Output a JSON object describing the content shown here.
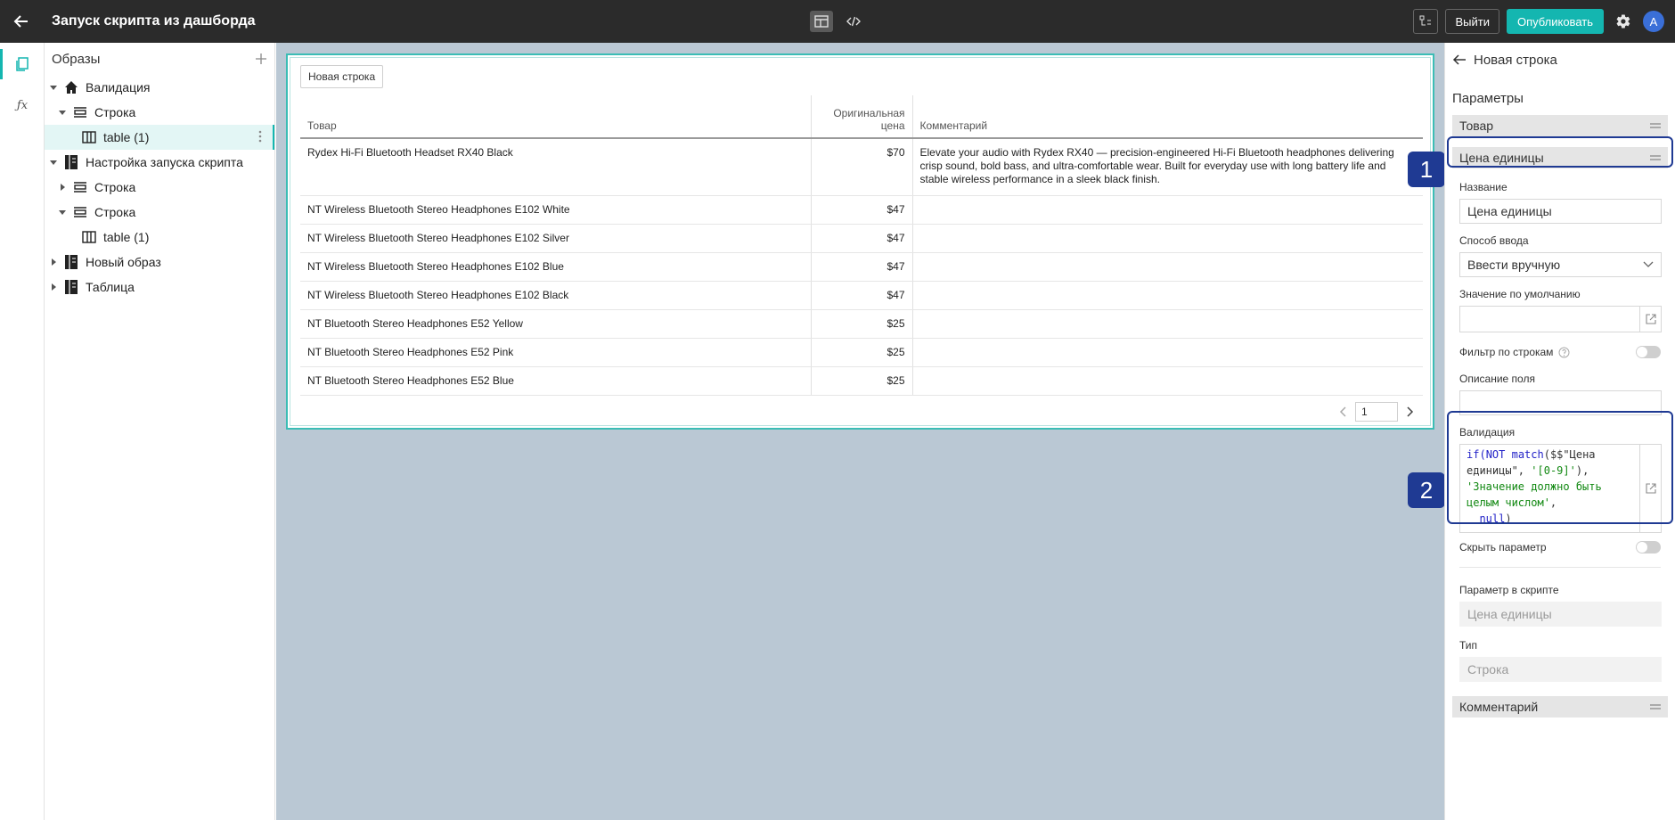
{
  "header": {
    "title": "Запуск скрипта из дашборда",
    "exit_label": "Выйти",
    "publish_label": "Опубликовать",
    "avatar_letter": "A"
  },
  "tree": {
    "title": "Образы",
    "nodes": [
      {
        "label": "Валидация",
        "icon": "home-icon",
        "expanded": true
      },
      {
        "label": "Строка",
        "icon": "row-icon",
        "expanded": true
      },
      {
        "label": "table (1)",
        "icon": "table-icon",
        "selected": true
      },
      {
        "label": "Настройка запуска скрипта",
        "icon": "form-icon",
        "expanded": true
      },
      {
        "label": "Строка",
        "icon": "row-icon",
        "expanded": false
      },
      {
        "label": "Строка",
        "icon": "row-icon",
        "expanded": true
      },
      {
        "label": "table (1)",
        "icon": "table-icon"
      },
      {
        "label": "Новый образ",
        "icon": "form-icon",
        "expanded": false
      },
      {
        "label": "Таблица",
        "icon": "form-icon",
        "expanded": false
      }
    ]
  },
  "canvas": {
    "new_row_label": "Новая строка",
    "columns": [
      "Товар",
      "Оригинальная цена",
      "Комментарий"
    ],
    "rows": [
      {
        "product": "Rydex Hi-Fi Bluetooth Headset RX40 Black",
        "price": "$70",
        "comment": "Elevate your audio with Rydex RX40 — precision-engineered Hi-Fi Bluetooth headphones delivering crisp sound, bold bass, and ultra-comfortable wear. Built for everyday use with long battery life and stable wireless performance in a sleek black finish."
      },
      {
        "product": "NT Wireless Bluetooth Stereo Headphones E102 White",
        "price": "$47",
        "comment": ""
      },
      {
        "product": "NT Wireless Bluetooth Stereo Headphones E102 Silver",
        "price": "$47",
        "comment": ""
      },
      {
        "product": "NT Wireless Bluetooth Stereo Headphones E102 Blue",
        "price": "$47",
        "comment": ""
      },
      {
        "product": "NT Wireless Bluetooth Stereo Headphones E102 Black",
        "price": "$47",
        "comment": ""
      },
      {
        "product": "NT Bluetooth Stereo Headphones E52 Yellow",
        "price": "$25",
        "comment": ""
      },
      {
        "product": "NT Bluetooth Stereo Headphones E52 Pink",
        "price": "$25",
        "comment": ""
      },
      {
        "product": "NT Bluetooth Stereo Headphones E52 Blue",
        "price": "$25",
        "comment": ""
      }
    ],
    "page": "1"
  },
  "badges": {
    "one": "1",
    "two": "2"
  },
  "panel": {
    "back_title": "Новая строка",
    "section": "Параметры",
    "group_product": "Товар",
    "group_unit_price": "Цена единицы",
    "name_label": "Название",
    "name_value": "Цена единицы",
    "input_mode_label": "Способ ввода",
    "input_mode_value": "Ввести вручную",
    "default_label": "Значение по умолчанию",
    "default_value": "",
    "row_filter_label": "Фильтр по строкам",
    "field_desc_label": "Описание поля",
    "field_desc_value": "",
    "validation_label": "Валидация",
    "code": {
      "if": "if(",
      "not": "NOT",
      "match": "match",
      "arg1a": "($$\"Цена",
      "arg1b": "единицы\",",
      "pattern": "'[0-9]'",
      "close1": "),",
      "msg1": "'Значение должно быть",
      "msg2": "целым числом'",
      "comma": ",",
      "null": "null",
      "close2": ")"
    },
    "hide_param_label": "Скрыть параметр",
    "script_param_label": "Параметр в скрипте",
    "script_param_value": "Цена единицы",
    "type_label": "Тип",
    "type_value": "Строка",
    "group_comment": "Комментарий"
  }
}
